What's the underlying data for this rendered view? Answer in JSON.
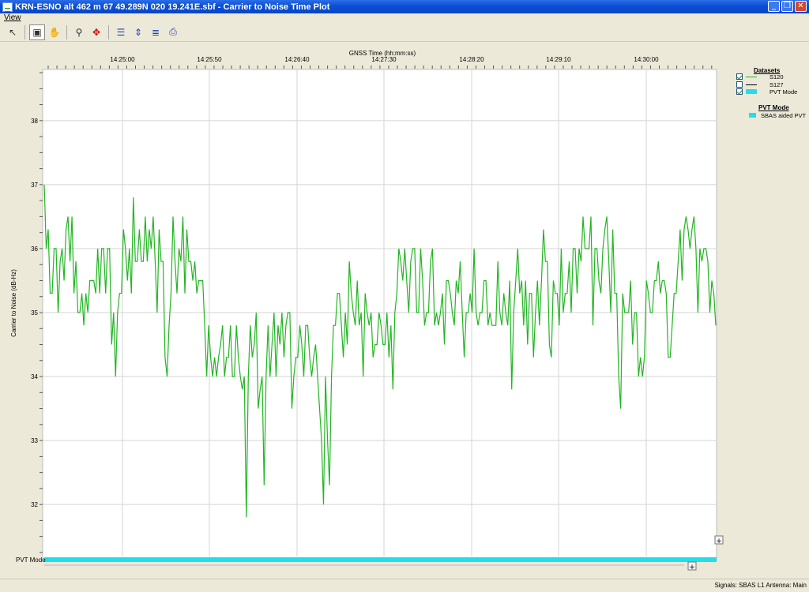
{
  "window": {
    "title": "KRN-ESNO alt 462 m 67 49.289N 020 19.241E.sbf - Carrier to Noise Time Plot",
    "minimize_glyph": "_",
    "restore_glyph": "❐",
    "close_glyph": "✕"
  },
  "menu": {
    "view_label": "View"
  },
  "toolbar": {
    "buttons": [
      {
        "icon": "pointer-icon",
        "glyph": "↖"
      },
      {
        "icon": "zoom-box-icon",
        "glyph": "▣"
      },
      {
        "icon": "pan-hand-icon",
        "glyph": "✋"
      },
      {
        "icon": "measure-icon",
        "glyph": "⚲"
      },
      {
        "icon": "fit-all-icon",
        "glyph": "✥"
      },
      {
        "icon": "horizontal-lines-icon",
        "glyph": "☰"
      },
      {
        "icon": "vertical-fit-icon",
        "glyph": "⇕"
      },
      {
        "icon": "legend-toggle-icon",
        "glyph": "≣"
      },
      {
        "icon": "print-icon",
        "glyph": "⎙"
      }
    ]
  },
  "colors": {
    "s120": "#22b522",
    "s127": "#000000",
    "pvt": "#1fe0ea",
    "grid": "#d4d4d4"
  },
  "legend": {
    "datasets_title": "Datasets",
    "items": [
      {
        "label": "S120",
        "checked": true
      },
      {
        "label": "S127",
        "checked": false
      },
      {
        "label": "PVT Mode",
        "checked": true
      }
    ],
    "pvt_title": "PVT Mode",
    "pvt_items": [
      {
        "label": "SBAS aided PVT"
      }
    ]
  },
  "pvt_row_label": "PVT Mode",
  "status": {
    "text": "Signals: SBAS L1    Antenna: Main"
  },
  "chart_data": {
    "type": "line",
    "xlabel": "GNSS Time (hh:mm:ss)",
    "ylabel": "Carrier to Noise (dB-Hz)",
    "x_ticks": [
      "14:25:00",
      "14:25:50",
      "14:26:40",
      "14:27:30",
      "14:28:20",
      "14:29:10",
      "14:30:00"
    ],
    "y_ticks": [
      32,
      33,
      34,
      35,
      36,
      37,
      38
    ],
    "ylim": [
      31.2,
      38.8
    ],
    "grid": true,
    "legend_position": "right",
    "series": [
      {
        "name": "S120",
        "values": [
          37.0,
          36.0,
          36.3,
          35.3,
          35.3,
          36.0,
          36.0,
          35.0,
          35.8,
          36.0,
          35.5,
          36.3,
          36.5,
          35.8,
          36.5,
          35.3,
          35.8,
          35.0,
          35.0,
          35.3,
          34.8,
          35.3,
          35.0,
          35.5,
          35.5,
          35.5,
          35.3,
          36.0,
          35.3,
          36.0,
          36.0,
          35.3,
          36.0,
          36.0,
          34.5,
          35.0,
          34.0,
          35.0,
          35.3,
          35.3,
          36.3,
          36.0,
          35.5,
          36.0,
          35.3,
          36.8,
          35.8,
          35.8,
          36.3,
          35.8,
          35.8,
          36.5,
          35.8,
          36.3,
          36.0,
          36.5,
          35.8,
          35.0,
          36.3,
          35.8,
          35.8,
          34.3,
          34.0,
          34.8,
          35.3,
          36.5,
          35.8,
          35.3,
          36.0,
          35.8,
          36.5,
          35.3,
          36.3,
          35.8,
          35.8,
          35.5,
          35.8,
          35.3,
          35.5,
          35.5,
          35.5,
          34.8,
          34.0,
          34.8,
          34.3,
          34.0,
          34.3,
          34.0,
          34.3,
          34.5,
          34.8,
          34.0,
          34.3,
          34.3,
          34.8,
          34.0,
          34.0,
          34.8,
          34.3,
          34.0,
          33.8,
          34.0,
          31.8,
          34.0,
          34.8,
          34.3,
          34.5,
          35.0,
          33.5,
          33.8,
          34.0,
          32.3,
          34.0,
          34.8,
          34.0,
          34.5,
          35.0,
          34.0,
          34.8,
          34.5,
          35.0,
          34.3,
          34.8,
          35.0,
          35.0,
          33.5,
          34.0,
          34.3,
          34.3,
          34.8,
          34.5,
          34.0,
          34.8,
          34.8,
          34.3,
          34.0,
          34.3,
          34.5,
          34.0,
          33.5,
          33.0,
          32.0,
          34.0,
          33.0,
          32.3,
          34.0,
          34.8,
          34.8,
          35.3,
          35.3,
          34.8,
          34.3,
          35.0,
          34.5,
          35.8,
          35.3,
          35.0,
          34.8,
          35.5,
          34.8,
          35.0,
          34.0,
          35.3,
          35.0,
          34.8,
          35.0,
          34.3,
          34.5,
          34.5,
          35.0,
          34.8,
          34.5,
          34.5,
          35.0,
          34.3,
          34.8,
          33.8,
          35.0,
          35.3,
          36.0,
          35.8,
          35.5,
          36.0,
          35.5,
          35.0,
          35.8,
          36.0,
          36.0,
          35.0,
          35.0,
          36.0,
          35.5,
          34.8,
          35.0,
          35.0,
          35.8,
          36.0,
          34.8,
          35.0,
          34.8,
          35.0,
          35.3,
          34.5,
          35.5,
          35.5,
          35.3,
          35.0,
          34.8,
          35.5,
          35.3,
          35.8,
          35.0,
          34.3,
          35.0,
          35.0,
          35.3,
          35.0,
          36.0,
          35.0,
          34.8,
          35.0,
          35.0,
          35.5,
          35.5,
          34.8,
          35.0,
          34.8,
          34.8,
          34.8,
          35.8,
          35.0,
          34.8,
          35.3,
          35.0,
          34.8,
          35.5,
          33.8,
          35.0,
          35.5,
          36.0,
          35.3,
          35.5,
          34.8,
          35.5,
          34.5,
          35.3,
          35.3,
          34.3,
          35.0,
          35.5,
          34.8,
          35.5,
          36.3,
          35.8,
          35.8,
          34.5,
          34.3,
          35.5,
          35.3,
          35.3,
          34.8,
          36.0,
          35.0,
          35.3,
          35.3,
          35.8,
          35.0,
          36.0,
          36.0,
          35.3,
          36.0,
          35.8,
          36.5,
          36.0,
          36.0,
          36.0,
          36.5,
          34.8,
          36.0,
          36.0,
          35.5,
          35.3,
          36.0,
          36.3,
          36.5,
          35.8,
          35.0,
          36.3,
          35.3,
          35.3,
          34.0,
          33.5,
          35.3,
          35.0,
          35.0,
          35.0,
          35.5,
          34.5,
          35.0,
          35.0,
          34.0,
          34.3,
          34.0,
          34.3,
          35.5,
          35.3,
          35.0,
          35.0,
          35.5,
          35.5,
          35.8,
          35.3,
          35.5,
          35.5,
          35.3,
          34.3,
          34.3,
          34.8,
          35.3,
          35.3,
          35.8,
          36.3,
          35.5,
          36.3,
          36.5,
          36.3,
          36.0,
          36.3,
          36.5,
          36.0,
          35.0,
          36.0,
          35.8,
          36.0,
          36.0,
          35.8,
          35.0,
          35.5,
          35.3,
          34.8
        ]
      },
      {
        "name": "S127",
        "values": []
      }
    ],
    "bands": [
      {
        "name": "PVT Mode",
        "value": "SBAS aided PVT"
      }
    ]
  }
}
